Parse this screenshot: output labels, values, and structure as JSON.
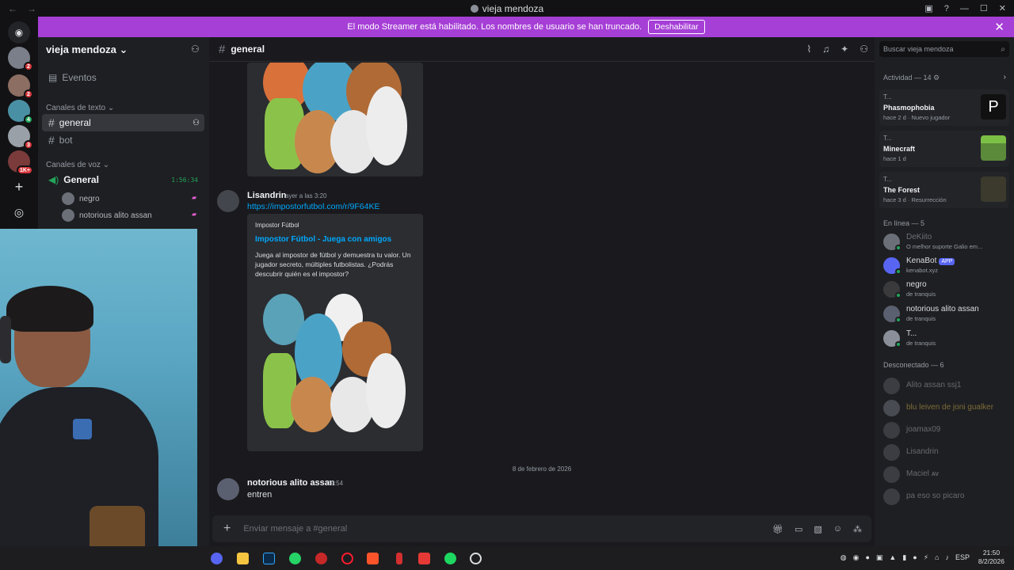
{
  "window": {
    "title": "vieja mendoza",
    "back": "←",
    "forward": "→"
  },
  "banner": {
    "text": "El modo Streamer está habilitado. Los nombres de usuario se han truncado.",
    "button": "Deshabilitar",
    "close": "✕"
  },
  "servers": [
    {
      "badge": "2"
    },
    {
      "badge": "2"
    },
    {
      "badge": "4"
    },
    {
      "badge": "3"
    },
    {
      "badge": "1K+"
    }
  ],
  "sidebar": {
    "guild": "vieja mendoza",
    "events": "Eventos",
    "text_category": "Canales de texto",
    "text_channels": [
      {
        "name": "general"
      },
      {
        "name": "bot"
      }
    ],
    "voice_category": "Canales de voz",
    "voice_channel": {
      "name": "General",
      "timer": "1:56:34"
    },
    "voice_users": [
      "negro",
      "notorious alito assan"
    ]
  },
  "chat": {
    "channel": "general",
    "messages": [
      {
        "author": "Lisandrin",
        "time": "ayer a las 3:20",
        "link": "https://impostorfutbol.com/r/9F64KE",
        "embed": {
          "provider": "Impostor Fútbol",
          "title": "Impostor Fútbol - Juega con amigos",
          "description": "Juega al impostor de fútbol y demuestra tu valor. Un jugador secreto, múltiples futbolistas. ¿Podrás descubrir quién es el impostor?"
        }
      },
      {
        "author": "notorious alito assan",
        "time": "19:54",
        "text": "entren"
      }
    ],
    "date_divider": "8 de febrero de 2026",
    "composer_placeholder": "Enviar mensaje a #general"
  },
  "right": {
    "search_placeholder": "Buscar vieja mendoza",
    "activity_header": "Actividad — 14",
    "activities": [
      {
        "user": "T...",
        "game": "Phasmophobia",
        "meta": "hace 2 d · Nuevo jugador",
        "color": "#111111"
      },
      {
        "user": "T...",
        "game": "Minecraft",
        "meta": "hace 1 d",
        "color": "#5b8a3a"
      },
      {
        "user": "T...",
        "game": "The Forest",
        "meta": "hace 3 d · Resurrección",
        "color": "#3b3a2c"
      }
    ],
    "online_header": "En línea — 5",
    "online": [
      {
        "name": "DeKiito",
        "status": "O melhor suporte Galio em..."
      },
      {
        "name": "KenaBot",
        "tag": "APP",
        "status": "kenabot.xyz"
      },
      {
        "name": "negro",
        "status": "de tranquis"
      },
      {
        "name": "notorious alito assan",
        "status": "de tranquis"
      },
      {
        "name": "T...",
        "status": "de tranquis"
      }
    ],
    "offline_header": "Desconectado — 6",
    "offline": [
      "Alito assan ssj1",
      "blu leiven de joni gualker",
      "joamax09",
      "Lisandrin",
      "Maciel",
      "pa eso so picaro"
    ],
    "offline_tag": "AV"
  },
  "taskbar": {
    "lang": "ESP",
    "time": "21:50",
    "date": "8/2/2026"
  }
}
